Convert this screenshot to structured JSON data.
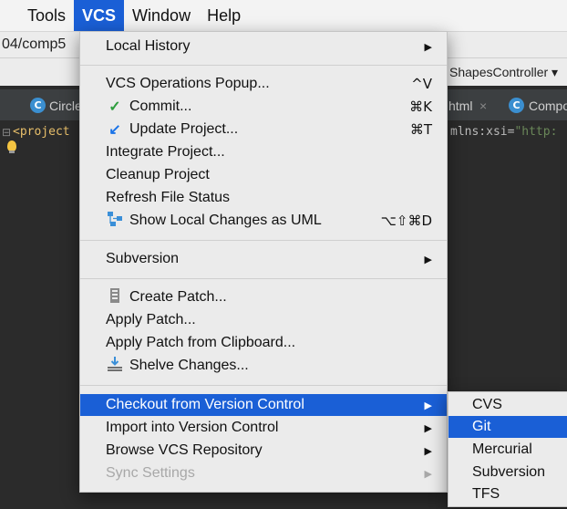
{
  "menubar": {
    "items": [
      "Tools",
      "VCS",
      "Window",
      "Help"
    ]
  },
  "ide": {
    "path_text": "04/comp5",
    "controller_text": "ShapesController ▾",
    "tabs": [
      {
        "icon": "C",
        "label": "Circle"
      },
      {
        "label": "html",
        "close": "×"
      },
      {
        "icon": "C",
        "label": "Compo"
      }
    ],
    "code": {
      "tag": "<project",
      "attr": "mlns:xsi",
      "eq": "=",
      "str": "\"http:"
    },
    "gutter_mark": "⊟"
  },
  "vcs_menu": {
    "local_history": {
      "label": "Local History",
      "arrow": "▶"
    },
    "operations_popup": {
      "label": "VCS Operations Popup...",
      "shortcut": "^V"
    },
    "commit": {
      "icon": "✓",
      "label": "Commit...",
      "shortcut": "⌘K"
    },
    "update_project": {
      "icon": "↙",
      "label": "Update Project...",
      "shortcut": "⌘T"
    },
    "integrate_project": {
      "label": "Integrate Project..."
    },
    "cleanup_project": {
      "label": "Cleanup Project"
    },
    "refresh_file_status": {
      "label": "Refresh File Status"
    },
    "show_local_changes": {
      "label": "Show Local Changes as UML",
      "shortcut": "⌥⇧⌘D"
    },
    "subversion": {
      "label": "Subversion",
      "arrow": "▶"
    },
    "create_patch": {
      "label": "Create Patch..."
    },
    "apply_patch": {
      "label": "Apply Patch..."
    },
    "apply_patch_clipboard": {
      "label": "Apply Patch from Clipboard..."
    },
    "shelve_changes": {
      "label": "Shelve Changes..."
    },
    "checkout": {
      "label": "Checkout from Version Control",
      "arrow": "▶"
    },
    "import": {
      "label": "Import into Version Control",
      "arrow": "▶"
    },
    "browse_repo": {
      "label": "Browse VCS Repository",
      "arrow": "▶"
    },
    "sync_settings": {
      "label": "Sync Settings",
      "arrow": "▶"
    }
  },
  "checkout_submenu": {
    "items": [
      "CVS",
      "Git",
      "Mercurial",
      "Subversion",
      "TFS"
    ]
  },
  "colors": {
    "highlight": "#1a5fd6",
    "menu_bg": "#ebebeb",
    "commit_check": "#2e9e3e",
    "update_arrow": "#1a73e8"
  }
}
